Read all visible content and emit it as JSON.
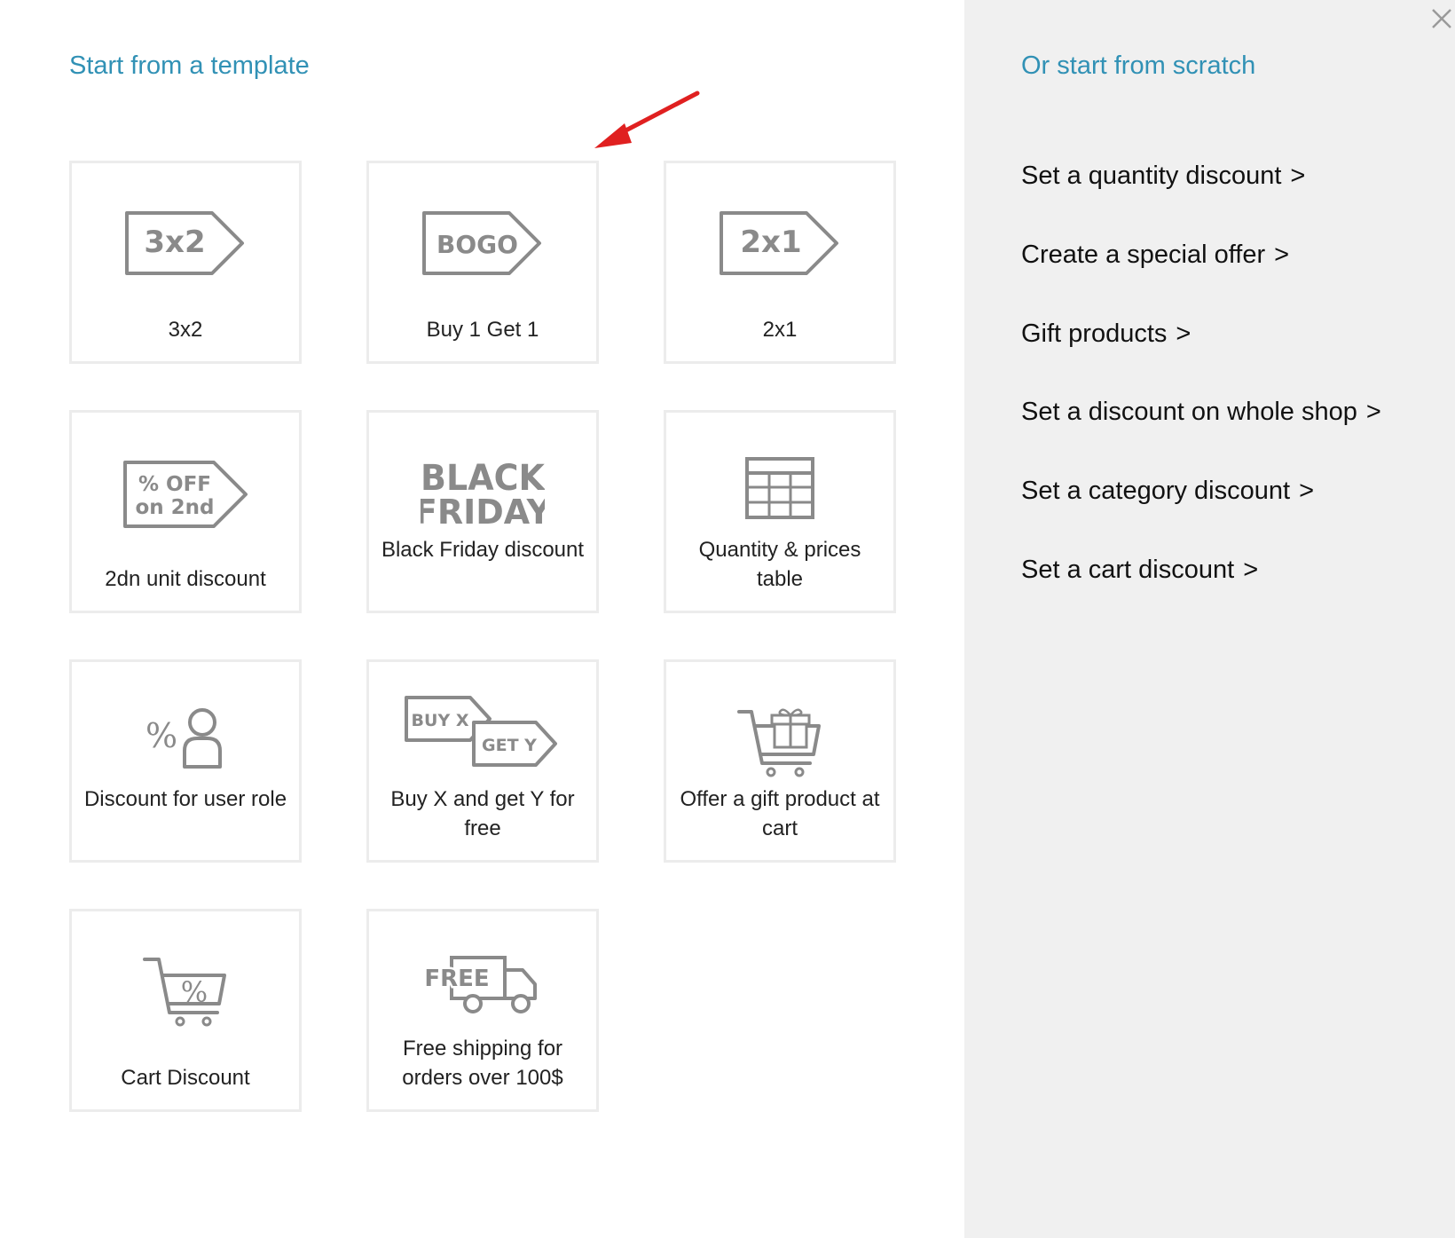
{
  "templates": {
    "title": "Start from a template",
    "cards": [
      {
        "label": "3x2",
        "icon": "tag-3x2-icon",
        "tag_text": "3x2"
      },
      {
        "label": "Buy 1 Get 1",
        "icon": "tag-bogo-icon",
        "tag_text": "BOGO"
      },
      {
        "label": "2x1",
        "icon": "tag-2x1-icon",
        "tag_text": "2x1"
      },
      {
        "label": "2dn unit discount",
        "icon": "tag-percent-off-2nd-icon",
        "tag_line1": "% OFF",
        "tag_line2": "on 2nd"
      },
      {
        "label": "Black Friday discount",
        "icon": "black-friday-icon",
        "tag_line1": "BLACK",
        "tag_line2": "FRIDAY"
      },
      {
        "label": "Quantity & prices table",
        "icon": "table-grid-icon"
      },
      {
        "label": "Discount for user role",
        "icon": "user-percent-icon",
        "symbol": "%"
      },
      {
        "label": "Buy X and get Y for free",
        "icon": "buy-x-get-y-icon",
        "tag_line1": "BUY X",
        "tag_line2": "GET Y"
      },
      {
        "label": "Offer a gift product at cart",
        "icon": "cart-gift-icon"
      },
      {
        "label": "Cart Discount",
        "icon": "cart-percent-icon",
        "symbol": "%"
      },
      {
        "label": "Free shipping for orders over 100$",
        "icon": "free-shipping-truck-icon",
        "tag_text": "FREE"
      }
    ]
  },
  "scratch": {
    "title": "Or start from scratch",
    "links": [
      {
        "label": "Set a quantity discount"
      },
      {
        "label": "Create a special offer"
      },
      {
        "label": "Gift products"
      },
      {
        "label": "Set a discount on whole shop"
      },
      {
        "label": "Set a category discount"
      },
      {
        "label": "Set a cart discount"
      }
    ],
    "chevron": ">"
  },
  "colors": {
    "accent": "#3191b5",
    "icon_gray": "#8a8a8a",
    "panel_bg": "#f0f0f0",
    "card_border": "#ececec",
    "annotation_arrow": "#e02020"
  }
}
